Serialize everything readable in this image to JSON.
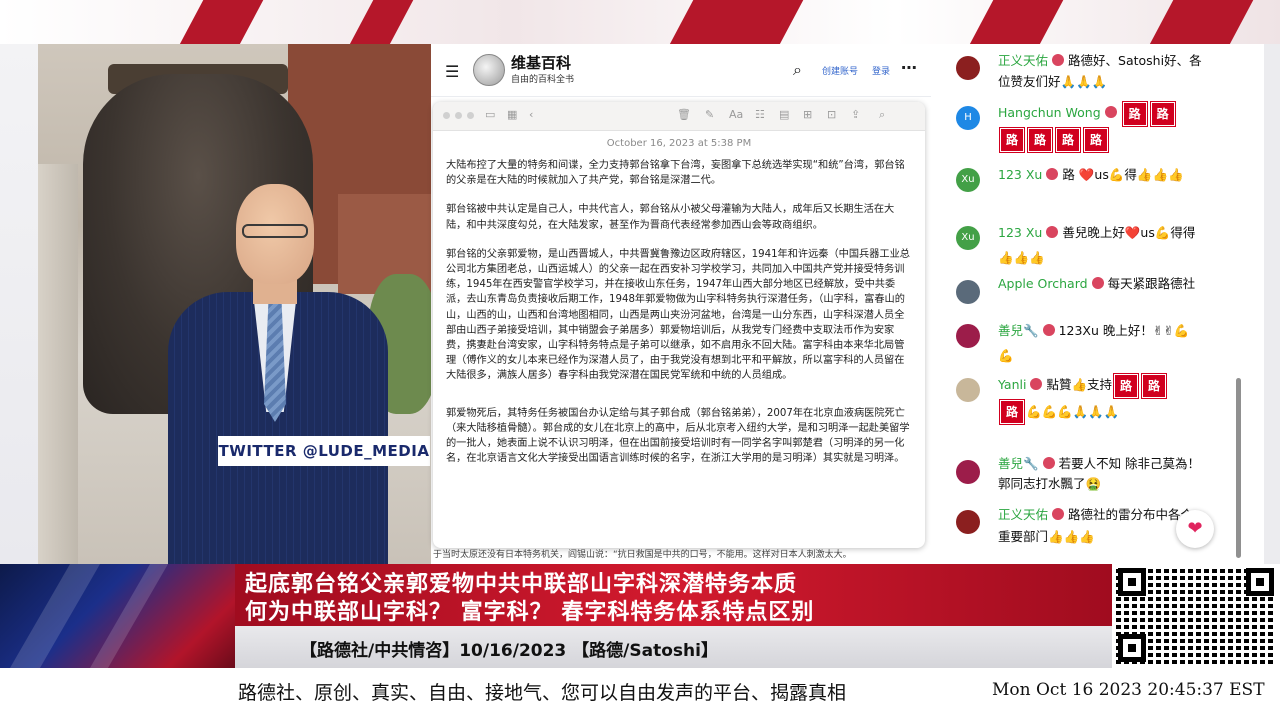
{
  "video": {
    "twitter_label": "TWITTER  @LUDE_MEDIA"
  },
  "wiki": {
    "title": "维基百科",
    "subtitle": "自由的百科全书",
    "create_account": "创建账号",
    "login": "登录",
    "below_text": "于当时太原还没有日本特务机关，阎锡山说：“抗日救国是中共的口号，不能用。这样对日本人刺激太大。"
  },
  "note": {
    "date": "October 16, 2023 at 5:38 PM",
    "paragraphs": [
      "大陆布控了大量的特务和间谍，全力支持郭台铭拿下台湾，妄图拿下总统选举实现“和统”台湾，郭台铭的父亲是在大陆的时候就加入了共产党，郭台铭是深潜二代。",
      "郭台铭被中共认定是自己人，中共代言人，郭台铭从小被父母灌输为大陆人，成年后又长期生活在大陆，和中共深度勾兑，在大陆发家，甚至作为晋商代表经常参加西山会等政商组织。",
      "郭台铭的父亲郭爱物，是山西晋城人，中共晋冀鲁豫边区政府辖区，1941年和许远秦（中国兵器工业总公司北方集团老总，山西运城人）的父亲一起在西安补习学校学习，共同加入中国共产党并接受特务训练，1945年在西安警官学校学习，并在接收山东任务，1947年山西大部分地区已经解放，受中共委派，去山东青岛负责接收后期工作，1948年郭爱物做为山字科特务执行深潜任务，（山字科，富春山的山，山西的山，山西和台湾地图相同，山西是两山夹汾河盆地，台湾是一山分东西，山字科深潜人员全部由山西子弟接受培训，其中销盟会子弟居多）郭爱物培训后，从我党专门经费中支取法币作为安家费，携妻赴台湾安家，山字科特务特点是子弟可以继承，如不启用永不回大陆。富字科由本来华北局管理（傅作义的女儿本来已经作为深潜人员了，由于我党没有想到北平和平解放，所以富字科的人员留在大陆很多，满族人居多）春字科由我党深潜在国民党军统和中统的人员组成。",
      "郭爱物死后，其特务任务被国台办认定给与其子郭台成（郭台铭弟弟），2007年在北京血液病医院死亡（来大陆移植骨髓）。郭台成的女儿在北京上的高中，后从北京考入纽约大学，是和习明泽一起赴美留学的一批人，她表面上说不认识习明泽，但在出国前接受培训时有一同学名字叫郭楚君（习明泽的另一化名，在北京语言文化大学接受出国语言训练时候的名字，在浙江大学用的是习明泽）其实就是习明泽。"
    ]
  },
  "chat": [
    {
      "name": "正义天佑",
      "avatar": "",
      "text": "路德好、Satoshi好、各位赞友们好🙏🙏🙏",
      "avatar_color": "#8b1f1f"
    },
    {
      "name": "Hangchun Wong",
      "avatar": "H",
      "text": "",
      "lu": [
        "路",
        "路",
        "路",
        "路",
        "路",
        "路"
      ],
      "avatar_color": "#1e88e5"
    },
    {
      "name": "123 Xu",
      "avatar": "Xu",
      "text": "路",
      "extra": "❤️us💪得👍👍👍",
      "avatar_color": "#43a047"
    },
    {
      "name": "123 Xu",
      "avatar": "Xu",
      "text": "善兒晚上好❤️us💪得得👍👍👍",
      "avatar_color": "#43a047"
    },
    {
      "name": "Apple Orchard",
      "avatar": "",
      "text": "每天紧跟路德社",
      "avatar_color": "#5a6a7a"
    },
    {
      "name": "善兒🔧",
      "avatar": "",
      "text": "123Xu 晚上好！✌✌💪💪",
      "avatar_color": "#9c1d4a"
    },
    {
      "name": "Yanli",
      "avatar": "",
      "text": "點贊👍支持",
      "lu": [
        "路",
        "路",
        "路"
      ],
      "extra": "💪💪💪🙏🙏🙏",
      "avatar_color": "#c8b79a"
    },
    {
      "name": "善兒🔧",
      "avatar": "",
      "text": "若要人不知 除非己莫為！郭同志打水飄了🤮",
      "avatar_color": "#9c1d4a"
    },
    {
      "name": "正义天佑",
      "avatar": "",
      "text": "路德社的雷分布中各个重要部门👍👍👍",
      "avatar_color": "#8b1f1f"
    }
  ],
  "banner": {
    "line1": "起底郭台铭父亲郭爱物中共中联部山字科深潜特务本质",
    "line2": "何为中联部山字科？  富字科？  春字科特务体系特点区别",
    "sub": "【路德社/中共情咨】10/16/2023 【路德/Satoshi】"
  },
  "ticker": "路德社、原创、真实、自由、接地气、您可以自由发声的平台、揭露真相",
  "clock": "Mon Oct 16 2023 20:45:37 EST"
}
